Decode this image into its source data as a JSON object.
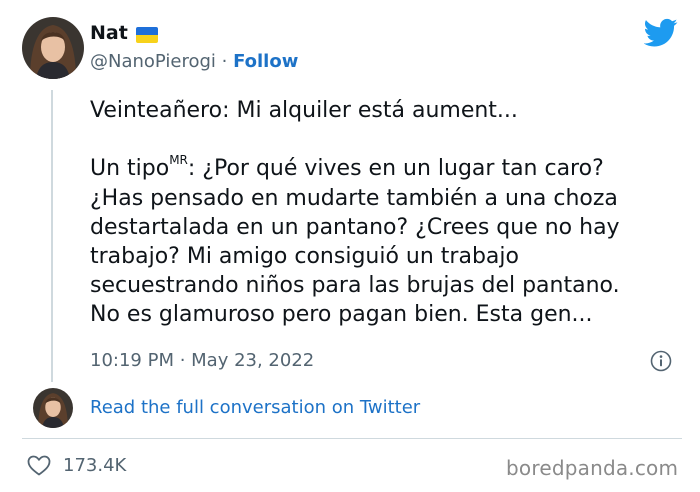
{
  "author": {
    "display_name": "Nat",
    "handle": "@NanoPierogi",
    "separator": " · ",
    "follow_label": "Follow",
    "flag_colors": [
      "#1e6fd9",
      "#f7d21b"
    ]
  },
  "tweet": {
    "line1": "Veinteañero: Mi alquiler está aument...",
    "line2_start": "Un tipo",
    "line2_sup": "MR",
    "line2_end": ": ¿Por qué vives en un lugar tan caro?",
    "line3": "¿Has pensado en mudarte también a una choza",
    "line4": "destartalada en un pantano? ¿Crees que no hay",
    "line5": "trabajo? Mi amigo consiguió un trabajo",
    "line6": "secuestrando niños para las brujas del pantano.",
    "line7": "No es glamuroso pero pagan bien. Esta gen..."
  },
  "timestamp": "10:19 PM · May 23, 2022",
  "conversation_link": "Read the full conversation on Twitter",
  "likes": "173.4K",
  "watermark": "boredpanda.com",
  "icons": {
    "logo": "twitter-bird-icon",
    "info": "info-icon",
    "like": "heart-icon"
  },
  "colors": {
    "link": "#1d72c7",
    "twitter_blue": "#1d9bf0",
    "secondary_text": "#536471",
    "thread_line": "#cfd9de"
  }
}
